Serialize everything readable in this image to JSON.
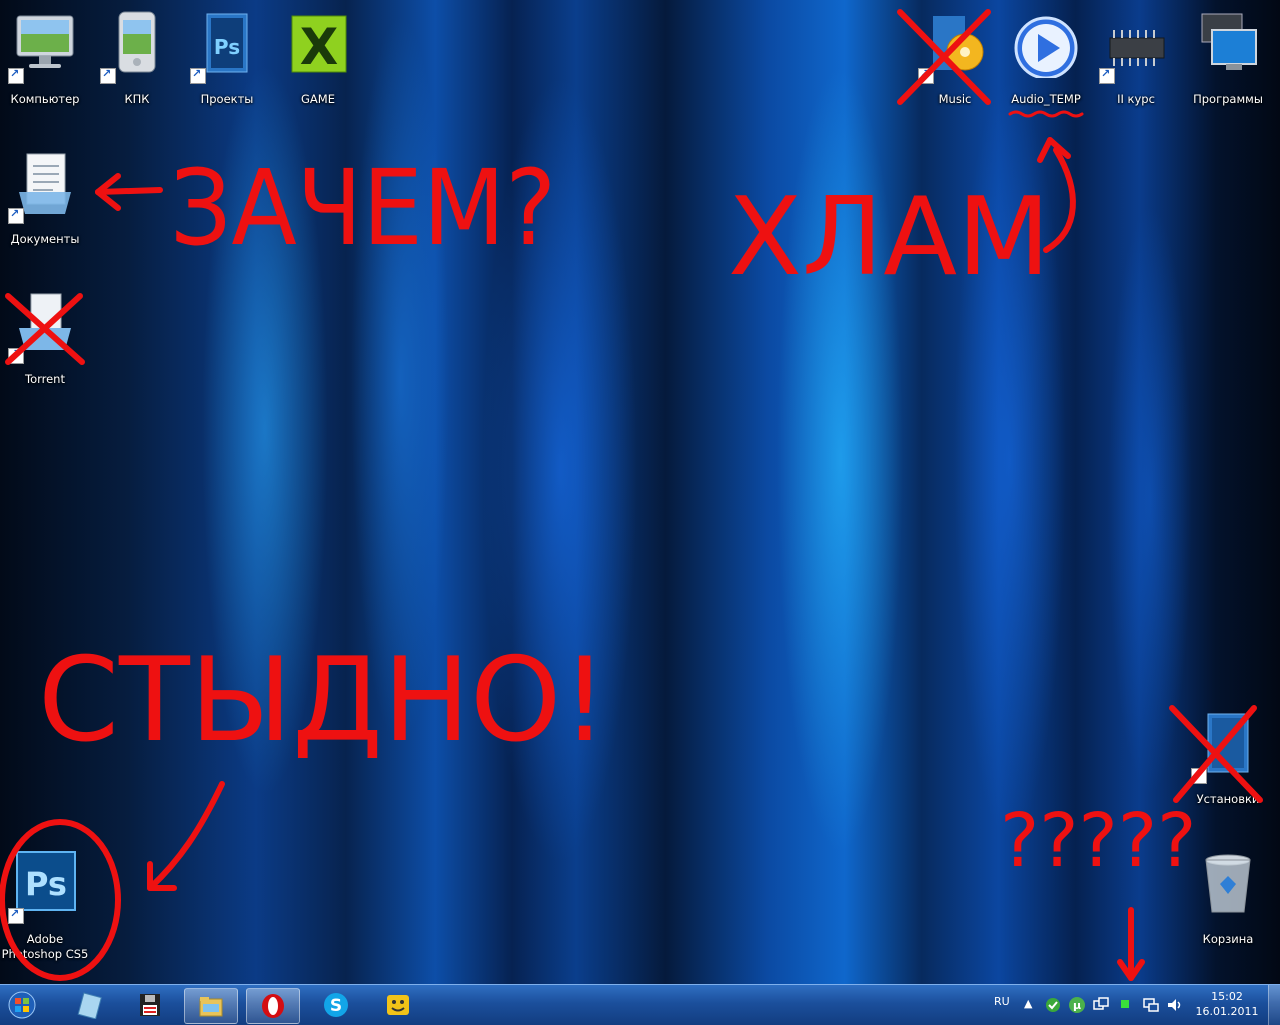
{
  "desktop": {
    "icons": [
      {
        "label": "Компьютер"
      },
      {
        "label": "КПК"
      },
      {
        "label": "Проекты"
      },
      {
        "label": "GAME"
      },
      {
        "label": "Music"
      },
      {
        "label": "Audio_TEMP"
      },
      {
        "label": "II курс"
      },
      {
        "label": "Программы"
      },
      {
        "label": "Документы"
      },
      {
        "label": "Torrent"
      },
      {
        "label": "Adobe Photoshop CS5"
      },
      {
        "label": "Установки"
      },
      {
        "label": "Корзина"
      }
    ]
  },
  "annotations": {
    "zachem": "ЗАЧЕМ?",
    "hlam": "ХЛАМ",
    "stydno": "СТЫДНО!",
    "questions": "?????",
    "color": "#ee1111"
  },
  "taskbar": {
    "language": "RU",
    "time": "15:02",
    "date": "16.01.2011",
    "accent": "#1b4f9c"
  }
}
